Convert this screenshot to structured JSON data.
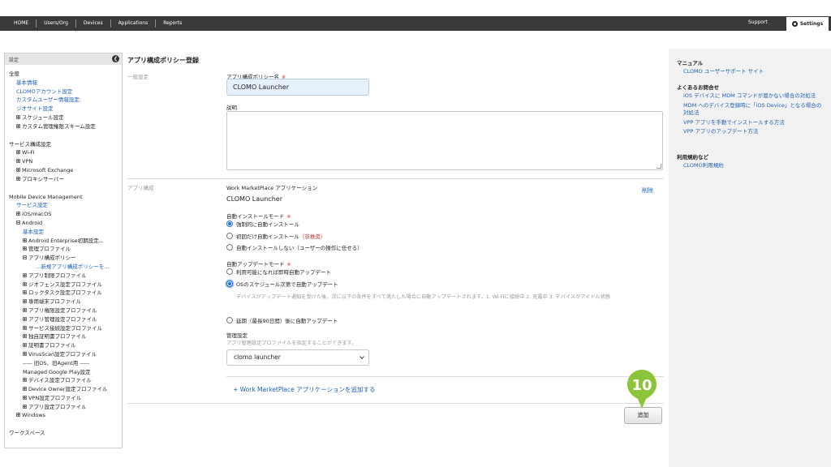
{
  "topnav": {
    "items": [
      "HOME",
      "Users/Org",
      "Devices",
      "Applications",
      "Reports"
    ],
    "support": "Support",
    "settings": "Settings"
  },
  "sidebar": {
    "header": "設定",
    "items": [
      {
        "text": "全般",
        "level": 0,
        "kind": "sec"
      },
      {
        "text": "基本情報",
        "level": 1,
        "kind": "link"
      },
      {
        "text": "CLOMOアカウント設定",
        "level": 1,
        "kind": "link"
      },
      {
        "text": "カスタムユーザー情報設定",
        "level": 1,
        "kind": "link"
      },
      {
        "text": "ジオサイト設定",
        "level": 1,
        "kind": "link"
      },
      {
        "text": "スケジュール設定",
        "level": 1,
        "kind": "item",
        "box": "plus"
      },
      {
        "text": "カスタム管理権限スキーム設定",
        "level": 1,
        "kind": "item",
        "box": "plus"
      },
      {
        "text": "",
        "level": 0,
        "kind": "gap"
      },
      {
        "text": "サービス構成設定",
        "level": 0,
        "kind": "sec"
      },
      {
        "text": "Wi-Fi",
        "level": 1,
        "kind": "item",
        "box": "plus"
      },
      {
        "text": "VPN",
        "level": 1,
        "kind": "item",
        "box": "plus"
      },
      {
        "text": "Microsoft Exchange",
        "level": 1,
        "kind": "item",
        "box": "plus"
      },
      {
        "text": "プロキシサーバー",
        "level": 1,
        "kind": "item",
        "box": "plus"
      },
      {
        "text": "",
        "level": 0,
        "kind": "gap"
      },
      {
        "text": "Mobile Device Management",
        "level": 0,
        "kind": "sec"
      },
      {
        "text": "サービス設定",
        "level": 1,
        "kind": "link"
      },
      {
        "text": "iOS/macOS",
        "level": 1,
        "kind": "item",
        "box": "plus"
      },
      {
        "text": "Android",
        "level": 1,
        "kind": "item",
        "box": "minus"
      },
      {
        "text": "基本設定",
        "level": 2,
        "kind": "link"
      },
      {
        "text": "Android Enterprise初期設定...",
        "level": 2,
        "kind": "item",
        "box": "plus"
      },
      {
        "text": "管理プロファイル",
        "level": 2,
        "kind": "item",
        "box": "plus"
      },
      {
        "text": "アプリ構成ポリシー",
        "level": 2,
        "kind": "item",
        "box": "minus"
      },
      {
        "text": "...新規アプリ構成ポリシーを...",
        "level": 4,
        "kind": "cur"
      },
      {
        "text": "アプリ制限プロファイル",
        "level": 2,
        "kind": "item",
        "box": "plus"
      },
      {
        "text": "ジオフェンス設定プロファイル",
        "level": 2,
        "kind": "item",
        "box": "plus"
      },
      {
        "text": "ロックタスク設定プロファイル",
        "level": 2,
        "kind": "item",
        "box": "plus"
      },
      {
        "text": "専用端末プロファイル",
        "level": 2,
        "kind": "item",
        "box": "plus"
      },
      {
        "text": "アプリ権限設定プロファイル",
        "level": 2,
        "kind": "item",
        "box": "plus"
      },
      {
        "text": "アプリ管理設定プロファイル",
        "level": 2,
        "kind": "item",
        "box": "plus"
      },
      {
        "text": "サービス接続設定プロファイル",
        "level": 2,
        "kind": "item",
        "box": "plus"
      },
      {
        "text": "独自証明書プロファイル",
        "level": 2,
        "kind": "item",
        "box": "plus"
      },
      {
        "text": "証明書プロファイル",
        "level": 2,
        "kind": "item",
        "box": "plus"
      },
      {
        "text": "VirusScan設定プロファイル",
        "level": 2,
        "kind": "item",
        "box": "plus"
      },
      {
        "text": "----- 旧OS、旧Agent用 -----",
        "level": 2,
        "kind": "item"
      },
      {
        "text": "Managed Google Play設定",
        "level": 2,
        "kind": "item"
      },
      {
        "text": "デバイス設定プロファイル",
        "level": 2,
        "kind": "item",
        "box": "plus"
      },
      {
        "text": "Device Owner設定プロファイル",
        "level": 2,
        "kind": "item",
        "box": "plus"
      },
      {
        "text": "VPN設定プロファイル",
        "level": 2,
        "kind": "item",
        "box": "plus"
      },
      {
        "text": "アプリ設定プロファイル",
        "level": 2,
        "kind": "item",
        "box": "plus"
      },
      {
        "text": "Windows",
        "level": 1,
        "kind": "item",
        "box": "plus"
      },
      {
        "text": "",
        "level": 0,
        "kind": "gap"
      },
      {
        "text": "ワークスペース",
        "level": 0,
        "kind": "sec"
      }
    ]
  },
  "main": {
    "title": "アプリ構成ポリシー登録",
    "general_section": "一般設定",
    "policy_name_label": "アプリ構成ポリシー名",
    "required_mark": "※",
    "policy_name_value": "CLOMO Launcher",
    "description_label": "説明",
    "app_section": "アプリ構成",
    "app_type_label": "Work MarketPlace アプリケーション",
    "app_name": "CLOMO Launcher",
    "delete_label": "削除",
    "auto_install_label": "自動インストールモード",
    "install_options": {
      "forced": "強制的に自動インストール",
      "once": "初回だけ自動インストール",
      "not_recommended": "（非推奨）",
      "none": "自動インストールしない（ユーザーの操作に任せる）"
    },
    "auto_update_label": "自動アップデートモード",
    "update_options": {
      "immediate": "利用可能になれば即時自動アップデート",
      "os_schedule": "OSのスケジュール次第で自動アップデート",
      "os_schedule_hint": "デバイスがアップデート通知を受けた後、次に以下の条件をすべて満たした場合に自動アップデートされます。1. Wi-Fiに接続中 2. 充電中 3. デバイスがアイドル状態",
      "postponed": "延期（最長90日間）後に自動アップデート"
    },
    "management_label": "管理設定",
    "management_hint": "アプリ管理設定プロファイルを指定することができます。",
    "management_select_value": "clomo launcher",
    "add_app_link": "+ Work MarketPlace アプリケーションを追加する",
    "add_button": "追加",
    "step_number": "10"
  },
  "right": {
    "manual_head": "マニュアル",
    "manual_links": [
      "CLOMO ユーザーサポート サイト"
    ],
    "faq_head": "よくあるお問合せ",
    "faq_links": [
      "iOS デバイスに MDM コマンドが届かない場合の対処法",
      "MDM へのデバイス登録時に「iOS Device」となる場合の対処法",
      "VPP アプリを手動でインストールする方法",
      "VPP アプリのアップデート方法"
    ],
    "terms_head": "利用規約など",
    "terms_links": [
      "CLOMO利用規約"
    ]
  },
  "colors": {
    "topbar": "#3a3a3a",
    "link": "#1d5fb4",
    "required": "#d03030",
    "marker": "#8cc43c",
    "input_bg": "#e6f0fb",
    "right_bg": "#f2f2f2"
  }
}
